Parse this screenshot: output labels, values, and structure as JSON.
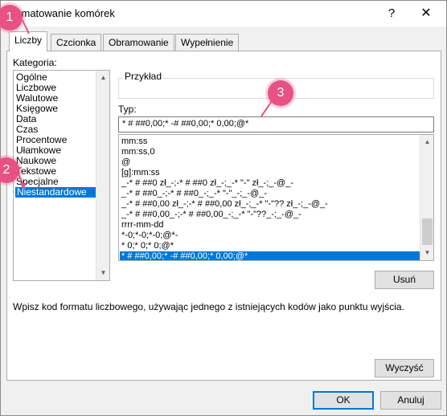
{
  "window": {
    "title": "Formatowanie komórek",
    "help_symbol": "?",
    "close_symbol": "✕"
  },
  "tabs": [
    {
      "label": "Liczby",
      "active": true
    },
    {
      "label": "Czcionka",
      "active": false
    },
    {
      "label": "Obramowanie",
      "active": false
    },
    {
      "label": "Wypełnienie",
      "active": false
    }
  ],
  "category": {
    "label": "Kategoria:",
    "items": [
      "Ogólne",
      "Liczbowe",
      "Walutowe",
      "Księgowe",
      "Data",
      "Czas",
      "Procentowe",
      "Ułamkowe",
      "Naukowe",
      "Tekstowe",
      "Specjalne",
      "Niestandardowe"
    ],
    "selected": "Niestandardowe"
  },
  "sample": {
    "label": "Przykład"
  },
  "type": {
    "label": "Typ:",
    "value": "* # ##0,00;* -# ##0,00;* 0,00;@*"
  },
  "format_list": {
    "items": [
      "mm:ss",
      "mm:ss,0",
      "@",
      "[g]:mm:ss",
      "_-* # ##0 zł_-;-* # ##0 zł_-;_-* \"-\" zł_-;_-@_-",
      "_-* # ##0_-;-* # ##0_-;_-* \"-\"_-;_-@_-",
      "_-* # ##0,00 zł_-;-* # ##0,00 zł_-;_-* \"-\"?? zł_-;_-@_-",
      "_-* # ##0,00_-;-* # ##0,00_-;_-* \"-\"??_-;_-@_-",
      "rrrr-mm-dd",
      "*-0;*-0;*-0;@*-",
      "* 0;* 0;* 0;@*",
      "* # ##0,00;* -# ##0,00;* 0,00;@*"
    ],
    "selected": "* # ##0,00;* -# ##0,00;* 0,00;@*"
  },
  "buttons": {
    "delete": "Usuń",
    "clear": "Wyczyść",
    "ok": "OK",
    "cancel": "Anuluj"
  },
  "description": "Wpisz kod formatu liczbowego, używając jednego z istniejących kodów jako punktu wyjścia.",
  "callouts": [
    "1",
    "2",
    "3"
  ],
  "colors": {
    "accent": "#0078d7",
    "callout": "#e75183"
  }
}
